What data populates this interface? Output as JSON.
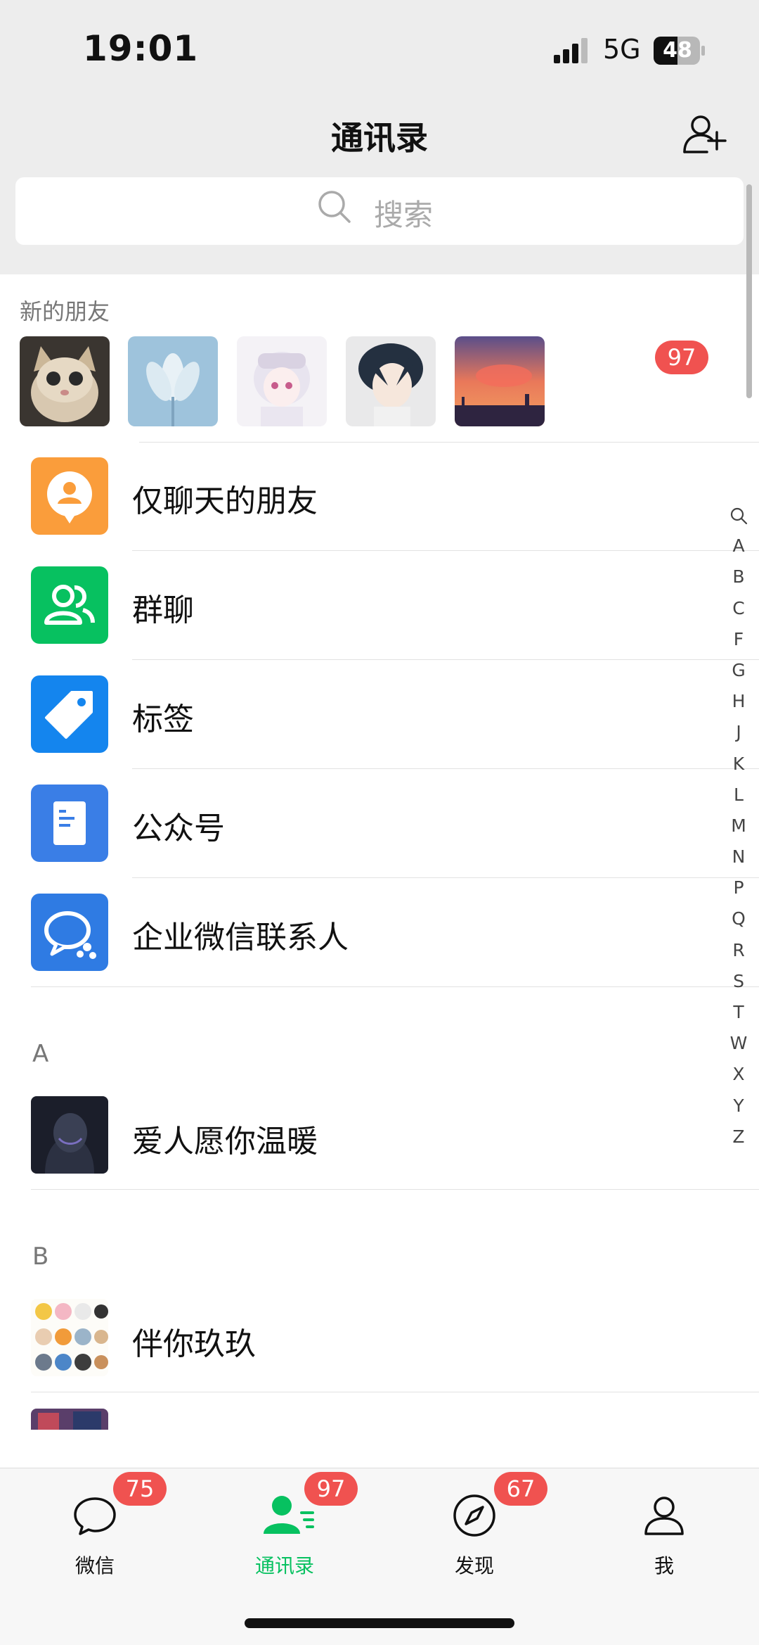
{
  "status_bar": {
    "time": "19:01",
    "network": "5G",
    "battery": "48"
  },
  "nav": {
    "title": "通讯录",
    "add_contact_icon": "add-contact-icon"
  },
  "search": {
    "placeholder": "搜索"
  },
  "new_friends": {
    "label": "新的朋友",
    "badge": "97",
    "avatars": [
      "cat",
      "flower",
      "anime-girl",
      "anime-boy",
      "sunset"
    ]
  },
  "functions": [
    {
      "label": "仅聊天的朋友",
      "icon": "chat-only-icon",
      "color": "#fa9d3b"
    },
    {
      "label": "群聊",
      "icon": "group-chat-icon",
      "color": "#07c160"
    },
    {
      "label": "标签",
      "icon": "tag-icon",
      "color": "#1485ee"
    },
    {
      "label": "公众号",
      "icon": "official-account-icon",
      "color": "#3a7ee6"
    },
    {
      "label": "企业微信联系人",
      "icon": "wecom-icon",
      "color": "#2f7be3"
    }
  ],
  "alphabet": [
    "A",
    "B",
    "C",
    "F",
    "G",
    "H",
    "J",
    "K",
    "L",
    "M",
    "N",
    "P",
    "Q",
    "R",
    "S",
    "T",
    "W",
    "X",
    "Y",
    "Z"
  ],
  "sections": [
    {
      "letter": "A",
      "contacts": [
        {
          "name": "爱人愿你温暖"
        }
      ]
    },
    {
      "letter": "B",
      "contacts": [
        {
          "name": "伴你玖玖"
        },
        {
          "name": ""
        }
      ]
    }
  ],
  "tabs": [
    {
      "label": "微信",
      "badge": "75",
      "icon": "chat-bubble-icon",
      "active": false
    },
    {
      "label": "通讯录",
      "badge": "97",
      "icon": "contacts-icon",
      "active": true
    },
    {
      "label": "发现",
      "badge": "67",
      "icon": "compass-icon",
      "active": false
    },
    {
      "label": "我",
      "badge": "",
      "icon": "person-icon",
      "active": false
    }
  ],
  "colors": {
    "accent": "#07c160",
    "badge": "#f05250",
    "background": "#ededed"
  }
}
